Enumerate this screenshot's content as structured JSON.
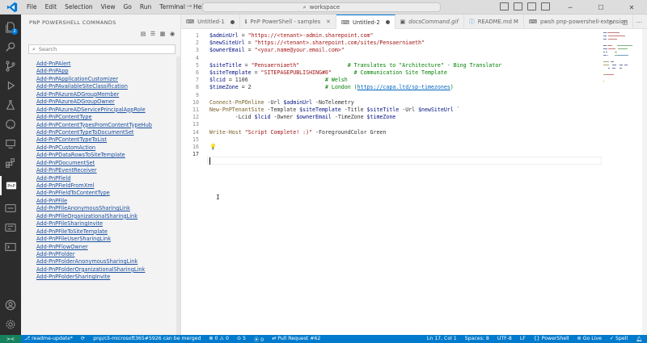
{
  "titlebar": {
    "menu": [
      "File",
      "Edit",
      "Selection",
      "View",
      "Go",
      "Run",
      "Terminal",
      "Help"
    ],
    "workspace": "workspace"
  },
  "sidebar": {
    "title": "PNP POWERSHELL COMMANDS",
    "search_placeholder": "Search",
    "commands": [
      "Add-PnPAlert",
      "Add-PnPApp",
      "Add-PnPApplicationCustomizer",
      "Add-PnPAvailableSiteClassification",
      "Add-PnPAzureADGroupMember",
      "Add-PnPAzureADGroupOwner",
      "Add-PnPAzureADServicePrincipalAppRole",
      "Add-PnPContentType",
      "Add-PnPContentTypesFromContentTypeHub",
      "Add-PnPContentTypeToDocumentSet",
      "Add-PnPContentTypeToList",
      "Add-PnPCustomAction",
      "Add-PnPDataRowsToSiteTemplate",
      "Add-PnPDocumentSet",
      "Add-PnPEventReceiver",
      "Add-PnPField",
      "Add-PnPFieldFromXml",
      "Add-PnPFieldToContentType",
      "Add-PnPFile",
      "Add-PnPFileAnonymousSharingLink",
      "Add-PnPFileOrganizationalSharingLink",
      "Add-PnPFileSharingInvite",
      "Add-PnPFileToSiteTemplate",
      "Add-PnPFileUserSharingLink",
      "Add-PnPFlowOwner",
      "Add-PnPFolder",
      "Add-PnPFolderAnonymousSharingLink",
      "Add-PnPFolderOrganizationalSharingLink",
      "Add-PnPFolderSharingInvite"
    ]
  },
  "activity": {
    "badge": "2"
  },
  "tabs": [
    {
      "label": "Untitled-1",
      "state": "dirty",
      "active": false
    },
    {
      "label": "PnP PowerShell - samples",
      "state": "close",
      "active": false
    },
    {
      "label": "Untitled-2",
      "state": "dirty",
      "active": true
    },
    {
      "label": "docsCommand.gif",
      "state": "none",
      "active": false
    },
    {
      "label": "README.md M",
      "state": "none",
      "active": false
    },
    {
      "label": "pwsh  pnp-powershell-extension",
      "state": "none",
      "active": false
    }
  ],
  "editor": {
    "lines": [
      {
        "n": "1",
        "parts": [
          [
            "v",
            "$adminUrl"
          ],
          [
            "p",
            " = "
          ],
          [
            "s",
            "\"https://<tenant>-admin.sharepoint.com\""
          ]
        ]
      },
      {
        "n": "2",
        "parts": [
          [
            "v",
            "$newSiteUrl"
          ],
          [
            "p",
            " = "
          ],
          [
            "s",
            "\"https://<tenant>.sharepoint.com/sites/Pensaerniaeth\""
          ]
        ]
      },
      {
        "n": "3",
        "parts": [
          [
            "v",
            "$ownerEmail"
          ],
          [
            "p",
            " = "
          ],
          [
            "s",
            "\"<your.name@your.email.com>\""
          ]
        ]
      },
      {
        "n": "4",
        "parts": []
      },
      {
        "n": "5",
        "parts": [
          [
            "v",
            "$siteTitle"
          ],
          [
            "p",
            " = "
          ],
          [
            "s",
            "\"Pensaerniaeth\""
          ],
          [
            "p",
            "               "
          ],
          [
            "c",
            "# Translates to \"Architecture\" - Bing Translator"
          ]
        ]
      },
      {
        "n": "6",
        "parts": [
          [
            "v",
            "$siteTemplate"
          ],
          [
            "p",
            " = "
          ],
          [
            "s",
            "\"SITEPAGEPUBLISHING#0\""
          ],
          [
            "p",
            "       "
          ],
          [
            "c",
            "# Communication Site Template"
          ]
        ]
      },
      {
        "n": "7",
        "parts": [
          [
            "v",
            "$lcid"
          ],
          [
            "p",
            " = "
          ],
          [
            "n",
            "1106"
          ],
          [
            "p",
            "                        "
          ],
          [
            "c",
            "# Welsh"
          ]
        ]
      },
      {
        "n": "8",
        "parts": [
          [
            "v",
            "$timeZone"
          ],
          [
            "p",
            " = "
          ],
          [
            "n",
            "2"
          ],
          [
            "p",
            "                       "
          ],
          [
            "c",
            "# London ("
          ],
          [
            "l",
            "https://capa.ltd/sp-timezones"
          ],
          [
            "c",
            ")"
          ]
        ]
      },
      {
        "n": "9",
        "parts": []
      },
      {
        "n": "10",
        "parts": [
          [
            "k",
            "Connect-PnPOnline"
          ],
          [
            "p",
            " -Url "
          ],
          [
            "v",
            "$adminUrl"
          ],
          [
            "p",
            " -NoTelemetry"
          ]
        ]
      },
      {
        "n": "11",
        "parts": [
          [
            "k",
            "New-PnPTenantSite"
          ],
          [
            "p",
            " -Template "
          ],
          [
            "v",
            "$siteTemplate"
          ],
          [
            "p",
            " -Title "
          ],
          [
            "v",
            "$siteTitle"
          ],
          [
            "p",
            " -Url "
          ],
          [
            "v",
            "$newSiteUrl"
          ],
          [
            "p",
            " `"
          ]
        ]
      },
      {
        "n": "12",
        "parts": [
          [
            "p",
            "        -Lcid "
          ],
          [
            "v",
            "$lcid"
          ],
          [
            "p",
            " -Owner "
          ],
          [
            "v",
            "$ownerEmail"
          ],
          [
            "p",
            " -TimeZone "
          ],
          [
            "v",
            "$timeZone"
          ]
        ]
      },
      {
        "n": "13",
        "parts": []
      },
      {
        "n": "14",
        "parts": [
          [
            "k",
            "Write-Host"
          ],
          [
            "p",
            " "
          ],
          [
            "s",
            "\"Script Complete! :)\""
          ],
          [
            "p",
            " -ForegroundColor Green"
          ]
        ]
      },
      {
        "n": "15",
        "parts": []
      },
      {
        "n": "16",
        "parts": [
          [
            "b",
            "💡"
          ]
        ]
      },
      {
        "n": "17",
        "parts": []
      }
    ]
  },
  "statusbar": {
    "remote": "><",
    "branch": "readme-update*",
    "pr": "pnp/cli-microsoft365#5926 can be merged",
    "problems": "⊗ 0 ⚠ 0",
    "ports": "⊙ 5",
    "count": "0",
    "pull_request": "Pull Request #62",
    "position": "Ln 17, Col 1",
    "spaces": "Spaces: 8",
    "encoding": "UTF-8",
    "eol": "LF",
    "language": "PowerShell",
    "golive": "Go Live",
    "spell": "Spell"
  },
  "colors": {
    "statusbar": "#007acc",
    "activitybar": "#2c2c2c",
    "accent": "#0078d4"
  }
}
